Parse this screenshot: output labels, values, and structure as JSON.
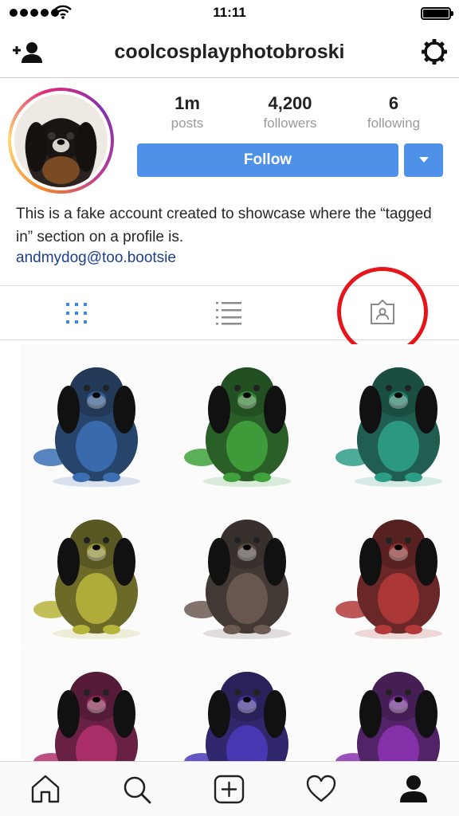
{
  "status_bar": {
    "time": "11:11"
  },
  "nav": {
    "username": "coolcosplayphotobroski"
  },
  "profile": {
    "stats": [
      {
        "value": "1m",
        "label": "posts"
      },
      {
        "value": "4,200",
        "label": "followers"
      },
      {
        "value": "6",
        "label": "following"
      }
    ],
    "follow_label": "Follow",
    "bio": "This is a fake account created to showcase where the “tagged in” section on a profile is.",
    "link": "andmydog@too.bootsie"
  },
  "tabs": [
    "grid-icon",
    "list-icon",
    "tagged-icon"
  ],
  "grid": {
    "tints": [
      "#3b6fb4",
      "#3fa23c",
      "#2d9e86",
      "#b7b43c",
      "#6b5b52",
      "#b33a3a",
      "#b02f6b",
      "#4a3ab8",
      "#8a33b0"
    ]
  },
  "tab_bar": [
    "home-icon",
    "search-icon",
    "add-post-icon",
    "activity-heart-icon",
    "profile-icon"
  ],
  "colors": {
    "accent": "#4e91e8",
    "highlight": "#e5161b",
    "link": "#1d3f8f"
  }
}
